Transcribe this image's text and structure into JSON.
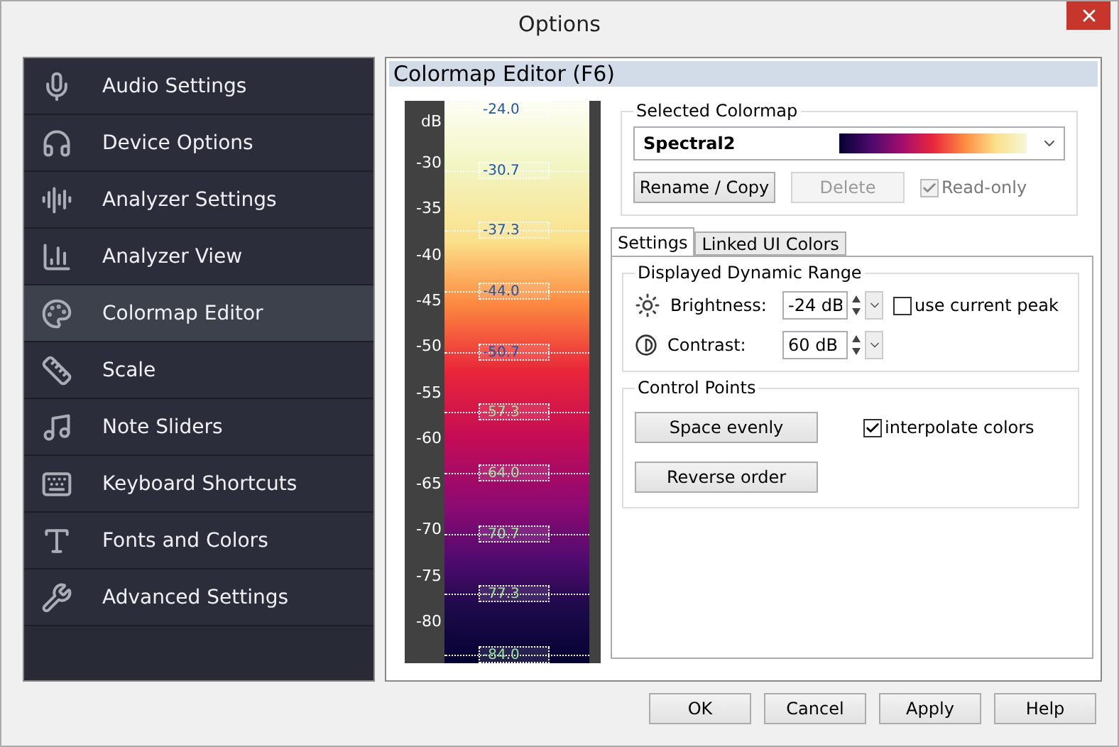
{
  "window": {
    "title": "Options"
  },
  "sidebar": {
    "items": [
      {
        "label": "Audio Settings",
        "selected": false
      },
      {
        "label": "Device Options",
        "selected": false
      },
      {
        "label": "Analyzer Settings",
        "selected": false
      },
      {
        "label": "Analyzer View",
        "selected": false
      },
      {
        "label": "Colormap Editor",
        "selected": true
      },
      {
        "label": "Scale",
        "selected": false
      },
      {
        "label": "Note Sliders",
        "selected": false
      },
      {
        "label": "Keyboard Shortcuts",
        "selected": false
      },
      {
        "label": "Fonts and Colors",
        "selected": false
      },
      {
        "label": "Advanced Settings",
        "selected": false
      }
    ]
  },
  "panel": {
    "title": "Colormap Editor (F6)"
  },
  "colorbar": {
    "scale_labels": [
      "dB",
      "-30",
      "-35",
      "-40",
      "-45",
      "-50",
      "-55",
      "-60",
      "-65",
      "-70",
      "-75",
      "-80"
    ],
    "control_points": [
      "-24.0",
      "-30.7",
      "-37.3",
      "-44.0",
      "-50.7",
      "-57.3",
      "-64.0",
      "-70.7",
      "-77.3",
      "-84.0"
    ]
  },
  "selected_colormap": {
    "legend": "Selected Colormap",
    "value": "Spectral2",
    "buttons": [
      {
        "label": "Rename / Copy",
        "disabled": false
      },
      {
        "label": "Delete",
        "disabled": true
      }
    ],
    "read_only": {
      "label": "Read-only",
      "checked": true,
      "disabled": true
    }
  },
  "tabs": [
    {
      "label": "Settings",
      "selected": true
    },
    {
      "label": "Linked UI Colors",
      "selected": false
    }
  ],
  "dynamic_range": {
    "legend": "Displayed Dynamic Range",
    "brightness": {
      "label": "Brightness:",
      "value": "-24 dB"
    },
    "use_peak": {
      "label": "use current peak",
      "checked": false
    },
    "contrast": {
      "label": "Contrast:",
      "value": "60 dB"
    }
  },
  "control_points": {
    "legend": "Control Points",
    "buttons": [
      "Space evenly",
      "Reverse order"
    ],
    "interpolate": {
      "label": "interpolate colors",
      "checked": true
    }
  },
  "footer_buttons": [
    "OK",
    "Cancel",
    "Apply",
    "Help"
  ]
}
